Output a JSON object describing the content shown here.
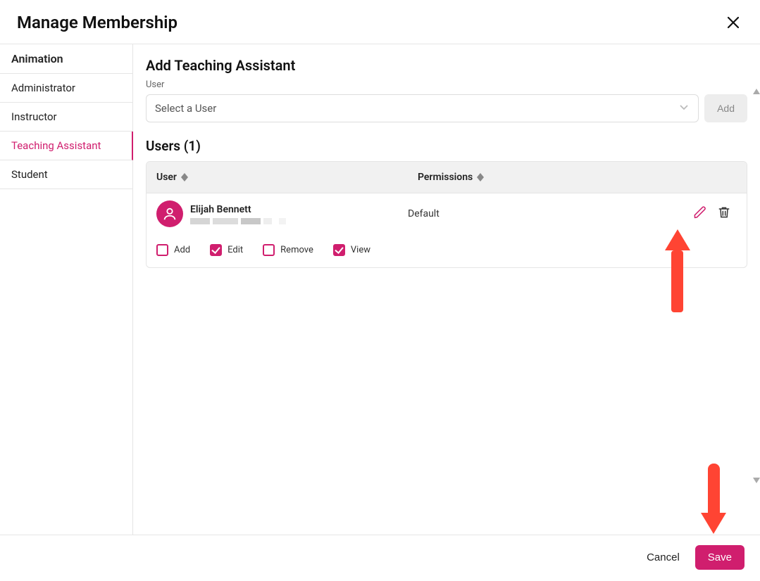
{
  "dialog": {
    "title": "Manage Membership"
  },
  "sidebar": {
    "header": "Animation",
    "items": [
      {
        "label": "Administrator"
      },
      {
        "label": "Instructor"
      },
      {
        "label": "Teaching Assistant"
      },
      {
        "label": "Student"
      }
    ]
  },
  "main": {
    "section_title": "Add Teaching Assistant",
    "user_field_label": "User",
    "select_placeholder": "Select a User",
    "add_button": "Add",
    "users_heading": "Users (1)",
    "columns": {
      "user": "User",
      "permissions": "Permissions"
    },
    "rows": [
      {
        "name": "Elijah Bennett",
        "permissions_text": "Default",
        "permission_flags": {
          "add": {
            "label": "Add",
            "checked": false
          },
          "edit": {
            "label": "Edit",
            "checked": true
          },
          "remove": {
            "label": "Remove",
            "checked": false
          },
          "view": {
            "label": "View",
            "checked": true
          }
        }
      }
    ]
  },
  "footer": {
    "cancel": "Cancel",
    "save": "Save"
  }
}
